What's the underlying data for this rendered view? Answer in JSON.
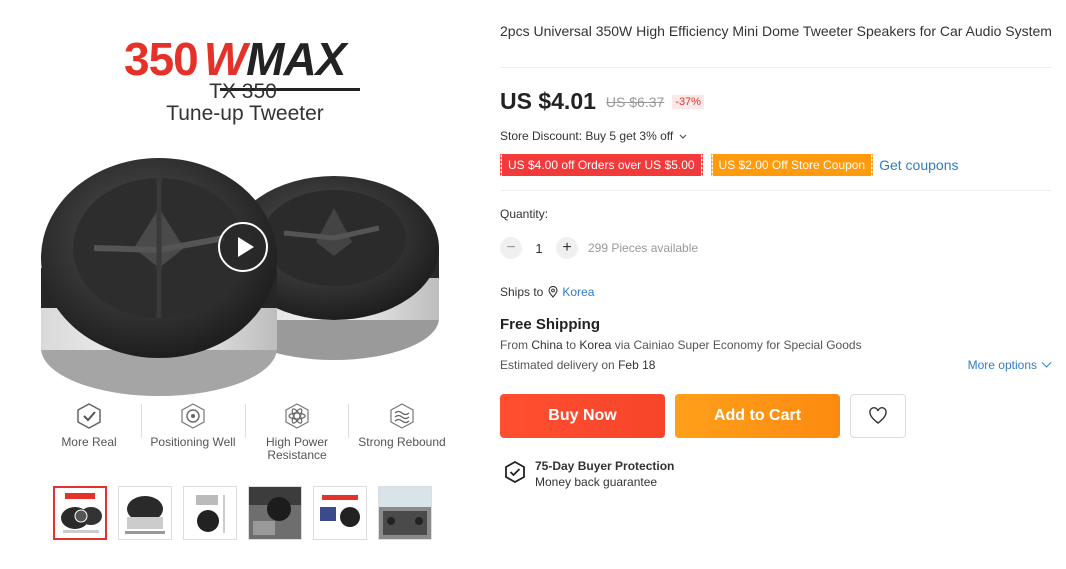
{
  "gallery": {
    "brand": {
      "num": "350",
      "w": "W",
      "max": "MAX"
    },
    "model_line1": "TX 350",
    "model_line2": "Tune-up Tweeter",
    "features": [
      {
        "label": "More Real",
        "icon": "checkmark-badge-icon"
      },
      {
        "label": "Positioning Well",
        "icon": "target-icon"
      },
      {
        "label": "High Power Resistance",
        "icon": "atom-icon"
      },
      {
        "label": "Strong Rebound",
        "icon": "wave-shield-icon"
      }
    ],
    "thumbnails_count": 6,
    "active_thumbnail": 1
  },
  "product": {
    "title": "2pcs Universal 350W High Efficiency Mini Dome Tweeter Speakers for Car Audio System",
    "price_current": "US $4.01",
    "price_original": "US $6.37",
    "discount": "-37%",
    "store_discount": "Store Discount: Buy 5 get 3% off",
    "coupon_1": "US $4.00 off Orders over US $5.00",
    "coupon_2": "US $2.00 Off Store Coupon",
    "get_coupons": "Get coupons",
    "quantity_label": "Quantity:",
    "quantity_value": "1",
    "quantity_available": "299 Pieces available",
    "ships_to_label": "Ships to",
    "ships_to_country": "Korea",
    "free_shipping": "Free Shipping",
    "route_from_label": "From",
    "route_from": "China",
    "route_to_label": "to",
    "route_to": "Korea",
    "route_via": "via Cainiao Super Economy for Special Goods",
    "delivery_label": "Estimated delivery on",
    "delivery_date": "Feb 18",
    "more_options": "More options",
    "buy_now": "Buy Now",
    "add_to_cart": "Add to Cart",
    "protection_title": "75-Day Buyer Protection",
    "protection_sub": "Money back guarantee"
  },
  "colors": {
    "accent_red": "#e4322b",
    "buy_button": "#f7452a",
    "cart_button": "#fd8a10",
    "link_blue": "#2e7ec5"
  }
}
